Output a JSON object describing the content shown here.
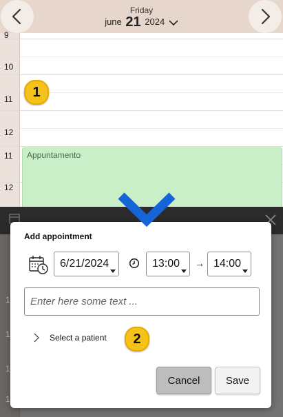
{
  "header": {
    "day_name": "Friday",
    "month": "june",
    "day_number": "21",
    "year": "2024"
  },
  "grid": {
    "hours": [
      "9",
      "10",
      "11",
      "12",
      "11",
      "12"
    ]
  },
  "appointment": {
    "title": "Appuntamento"
  },
  "badges": {
    "first": "1",
    "second": "2"
  },
  "dialog": {
    "title": "Add appointment",
    "date_value": "6/21/2024",
    "start_time": "13:00",
    "end_time": "14:00",
    "arrow": "→",
    "text_placeholder": "Enter here some text ...",
    "select_patient_label": "Select a patient",
    "cancel_label": "Cancel",
    "save_label": "Save"
  },
  "background_rows": [
    "1",
    "1",
    "1",
    "1",
    "1"
  ],
  "colors": {
    "header_bg": "#e6d6cc",
    "appointment_bg": "#c9efc9",
    "accent_chevron": "#1565d8",
    "badge": "#f5c21b"
  },
  "icons": {
    "prev": "chevron-left-icon",
    "next": "chevron-right-icon",
    "date_picker": "calendar-clock-icon",
    "time": "clock-icon",
    "expand": "chevron-right-icon"
  }
}
